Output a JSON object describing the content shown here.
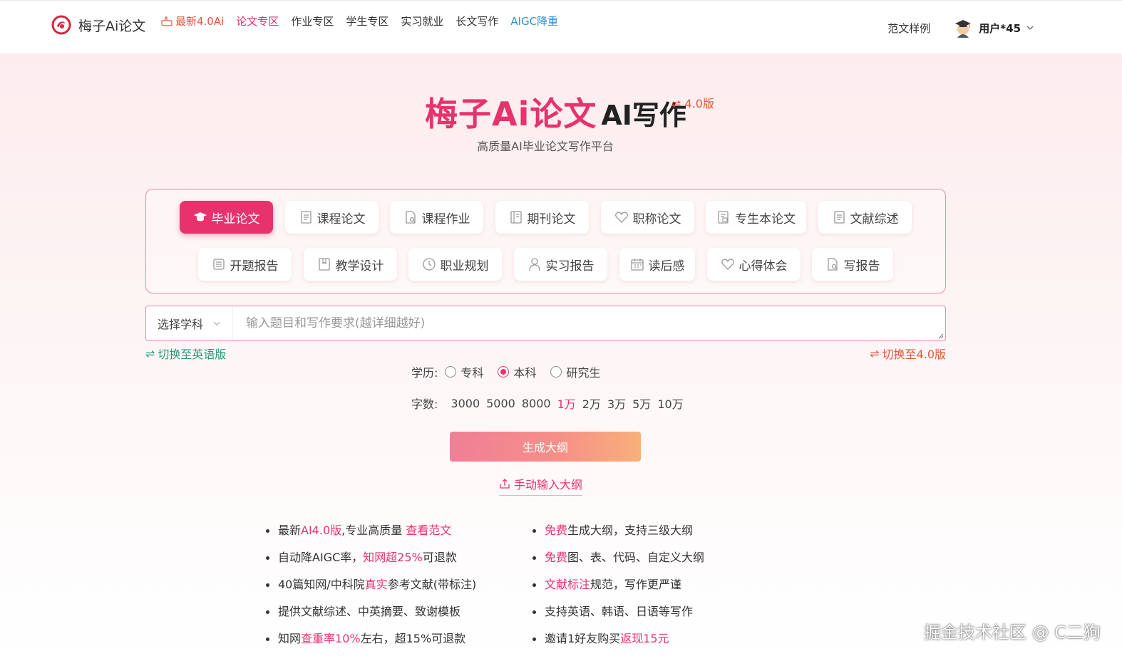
{
  "header": {
    "brand": "梅子Ai论文",
    "nav": [
      {
        "label": "最新4.0Ai"
      },
      {
        "label": "论文专区"
      },
      {
        "label": "作业专区"
      },
      {
        "label": "学生专区"
      },
      {
        "label": "实习就业"
      },
      {
        "label": "长文写作"
      },
      {
        "label": "AIGC降重"
      }
    ],
    "examples_link": "范文样例",
    "user_name": "用户*45"
  },
  "hero": {
    "title_main": "梅子Ai论文",
    "title_sub": "AI写作",
    "version_tag": "⇌ 4.0版",
    "tagline": "高质量AI毕业论文写作平台"
  },
  "categories": [
    {
      "label": "毕业论文",
      "icon": "graduation-cap-icon"
    },
    {
      "label": "课程论文",
      "icon": "document-icon"
    },
    {
      "label": "课程作业",
      "icon": "file-search-icon"
    },
    {
      "label": "期刊论文",
      "icon": "journal-icon"
    },
    {
      "label": "职称论文",
      "icon": "heart-icon"
    },
    {
      "label": "专生本论文",
      "icon": "file-edit-icon"
    },
    {
      "label": "文献综述",
      "icon": "document-icon"
    },
    {
      "label": "开题报告",
      "icon": "report-icon"
    },
    {
      "label": "教学设计",
      "icon": "book-icon"
    },
    {
      "label": "职业规划",
      "icon": "clock-icon"
    },
    {
      "label": "实习报告",
      "icon": "person-icon"
    },
    {
      "label": "读后感",
      "icon": "calendar-icon"
    },
    {
      "label": "心得体会",
      "icon": "heart-icon"
    },
    {
      "label": "写报告",
      "icon": "file-search-icon"
    }
  ],
  "form": {
    "subject_select": "选择学科",
    "topic_placeholder": "输入题目和写作要求(越详细越好)",
    "switch_en": "切换至英语版",
    "switch_v4": "切换至4.0版",
    "edu_label": "学历:",
    "edu_options": [
      "专科",
      "本科",
      "研究生"
    ],
    "edu_selected": "本科",
    "words_label": "字数:",
    "word_options": [
      "3000",
      "5000",
      "8000",
      "1万",
      "2万",
      "3万",
      "5万",
      "10万"
    ],
    "word_selected": "1万",
    "generate_button": "生成大纲",
    "manual_outline": "手动输入大纲"
  },
  "features": {
    "left": [
      {
        "parts": [
          {
            "t": "最新"
          },
          {
            "t": "AI4.0版",
            "hl": true
          },
          {
            "t": ",专业高质量 "
          },
          {
            "t": "查看范文",
            "hl": true
          }
        ]
      },
      {
        "parts": [
          {
            "t": "自动降AIGC率，"
          },
          {
            "t": "知网超25%",
            "hl": true
          },
          {
            "t": "可退款"
          }
        ]
      },
      {
        "parts": [
          {
            "t": "40篇知网/中科院"
          },
          {
            "t": "真实",
            "hl": true
          },
          {
            "t": "参考文献(带标注)"
          }
        ]
      },
      {
        "parts": [
          {
            "t": "提供文献综述、中英摘要、致谢模板"
          }
        ]
      },
      {
        "parts": [
          {
            "t": "知网"
          },
          {
            "t": "查重率10%",
            "hl": true
          },
          {
            "t": "左右，超15%可退款"
          }
        ]
      }
    ],
    "right": [
      {
        "parts": [
          {
            "t": "免费",
            "hl": true
          },
          {
            "t": "生成大纲，支持三级大纲"
          }
        ]
      },
      {
        "parts": [
          {
            "t": "免费",
            "hl": true
          },
          {
            "t": "图、表、代码、自定义大纲"
          }
        ]
      },
      {
        "parts": [
          {
            "t": "文献标注",
            "hl": true
          },
          {
            "t": "规范，写作更严谨"
          }
        ]
      },
      {
        "parts": [
          {
            "t": "支持英语、韩语、日语等写作"
          }
        ]
      },
      {
        "parts": [
          {
            "t": "邀请1好友购买"
          },
          {
            "t": "返现15元",
            "hl": true
          }
        ]
      }
    ]
  },
  "watermark": "掘金技术社区 @ C二狗",
  "colors": {
    "brand": "#e8326e",
    "accent_orange": "#e5563a",
    "accent_blue": "#2f8fd6",
    "accent_green": "#2a9a7a"
  }
}
